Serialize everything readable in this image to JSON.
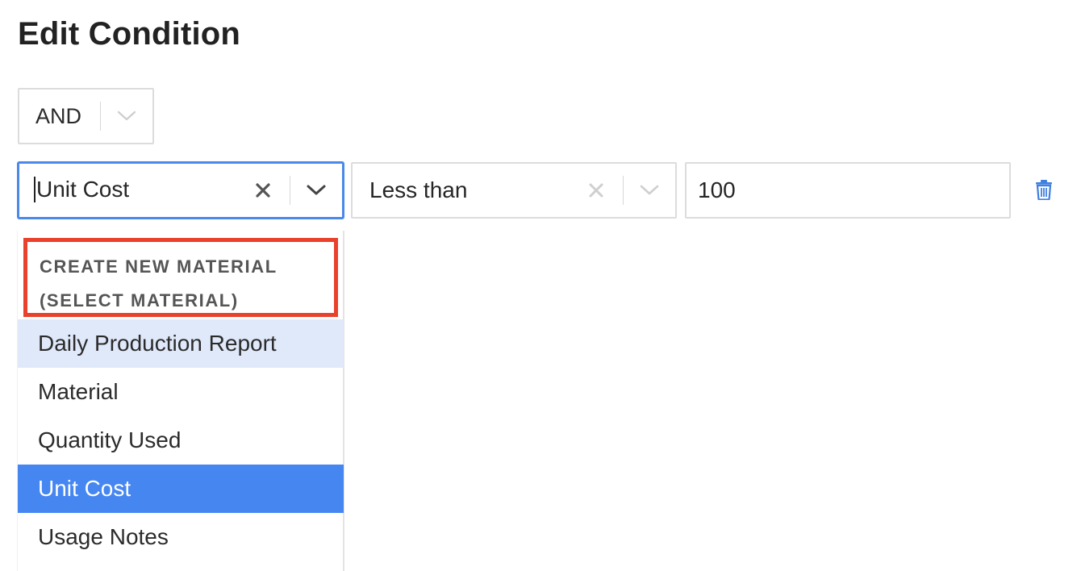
{
  "page": {
    "title": "Edit Condition"
  },
  "logic": {
    "value": "AND"
  },
  "condition": {
    "field": "Unit Cost",
    "operator": "Less than",
    "value": "100"
  },
  "menu": {
    "group_header_line1": "CREATE NEW MATERIAL",
    "group_header_line2": "(SELECT MATERIAL)",
    "options": [
      {
        "label": "Daily Production Report",
        "state": "hover"
      },
      {
        "label": "Material",
        "state": "normal"
      },
      {
        "label": "Quantity Used",
        "state": "normal"
      },
      {
        "label": "Unit Cost",
        "state": "selected"
      },
      {
        "label": "Usage Notes",
        "state": "normal"
      }
    ]
  },
  "icons": {
    "clear": "close-icon",
    "dropdown": "chevron-down-icon",
    "delete": "trash-icon"
  },
  "colors": {
    "focus_border": "#4a88ea",
    "selected_option": "#4586f1",
    "hover_option": "#e0e9fa",
    "highlight_box": "#e9412b",
    "trash_icon": "#3f7fe0"
  }
}
